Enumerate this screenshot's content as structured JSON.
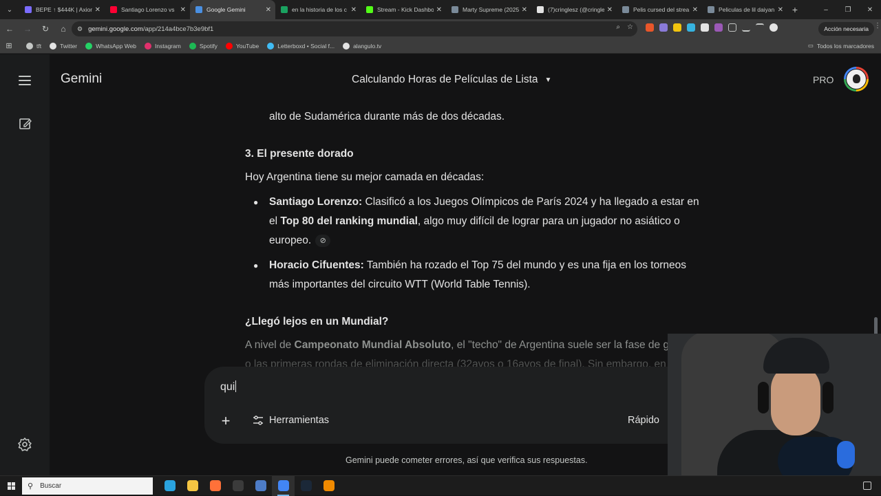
{
  "browser": {
    "tabs": [
      {
        "title": "BEPE ↑ $444K | Axiom",
        "color": "#7b6cff"
      },
      {
        "title": "Santiago Lorenzo vs ",
        "color": "#ff0033"
      },
      {
        "title": "Google Gemini",
        "color": "#4a90e2",
        "active": true
      },
      {
        "title": "en la historia de los c",
        "color": "#1aa260"
      },
      {
        "title": "Stream - Kick Dashbo",
        "color": "#53fc18"
      },
      {
        "title": "Marty Supreme (2025",
        "color": "#7a8a99"
      },
      {
        "title": "(7)cringlesz (@cringle",
        "color": "#e3e3e3"
      },
      {
        "title": "Pelis cursed del strea",
        "color": "#7a8a99"
      },
      {
        "title": "Peliculas de lil daiyan",
        "color": "#7a8a99"
      }
    ],
    "url_host": "gemini.google.com",
    "url_path": "/app/214a4bce7b3e9bf1",
    "profile_action": "Acción necesaria",
    "bookmarks": [
      {
        "label": "tft",
        "color": "#c4c7c5"
      },
      {
        "label": "Twitter",
        "color": "#e3e3e3"
      },
      {
        "label": "WhatsApp Web",
        "color": "#25d366"
      },
      {
        "label": "Instagram",
        "color": "#e1306c"
      },
      {
        "label": "Spotify",
        "color": "#1db954"
      },
      {
        "label": "YouTube",
        "color": "#ff0000"
      },
      {
        "label": "Letterboxd • Social f...",
        "color": "#40bcf4"
      },
      {
        "label": "alangulo.tv",
        "color": "#e3e3e3"
      }
    ],
    "all_bookmarks": "Todos los marcadores"
  },
  "app": {
    "brand": "Gemini",
    "conversation_title": "Calculando Horas de Películas de Lista",
    "plan_badge": "PRO"
  },
  "response": {
    "prev_line": "alto de Sudamérica durante más de dos décadas.",
    "section_heading": "3. El presente dorado",
    "intro": "Hoy Argentina tiene su mejor camada en décadas:",
    "bullet1_name": "Santiago Lorenzo:",
    "bullet1_line1": " Clasificó a los Juegos Olímpicos de París 2024 y ha llegado a estar en",
    "bullet1_line2_pre": "el ",
    "bullet1_line2_bold": "Top 80 del ranking mundial",
    "bullet1_line2_post": ", algo muy difícil de lograr para un jugador no asiático o",
    "bullet1_line3": "europeo.",
    "bullet2_name": "Horacio Cifuentes:",
    "bullet2_line1": " También ha rozado el Top 75 del mundo y es una fija en los torneos",
    "bullet2_line2": "más importantes del circuito WTT (World Table Tennis).",
    "question_heading": "¿Llegó lejos en un Mundial?",
    "para_pre": "A nivel de ",
    "para_bold": "Campeonato Mundial Absoluto",
    "para_post": ", el \"techo\" de Argentina suele ser la fase de g",
    "para_line2": "o las primeras rondas de eliminación directa (32avos o 16avos de final). Sin embargo, en"
  },
  "composer": {
    "typed_text": "qui",
    "tools_label": "Herramientas",
    "mode_label": "Rápido"
  },
  "disclaimer": "Gemini puede cometer errores, así que verifica sus respuestas.",
  "taskbar": {
    "search_placeholder": "Buscar",
    "apps": [
      {
        "name": "telegram-icon",
        "color": "#2aa3df"
      },
      {
        "name": "file-explorer-icon",
        "color": "#f5c542"
      },
      {
        "name": "firefox-icon",
        "color": "#ff7139"
      },
      {
        "name": "obs-icon",
        "color": "#3b3b3b"
      },
      {
        "name": "badge-app-icon",
        "color": "#4d7cc7"
      },
      {
        "name": "chrome-icon",
        "color": "#4285f4",
        "active": true
      },
      {
        "name": "steam-icon",
        "color": "#1b2838"
      },
      {
        "name": "vlc-icon",
        "color": "#f08a00"
      }
    ]
  }
}
